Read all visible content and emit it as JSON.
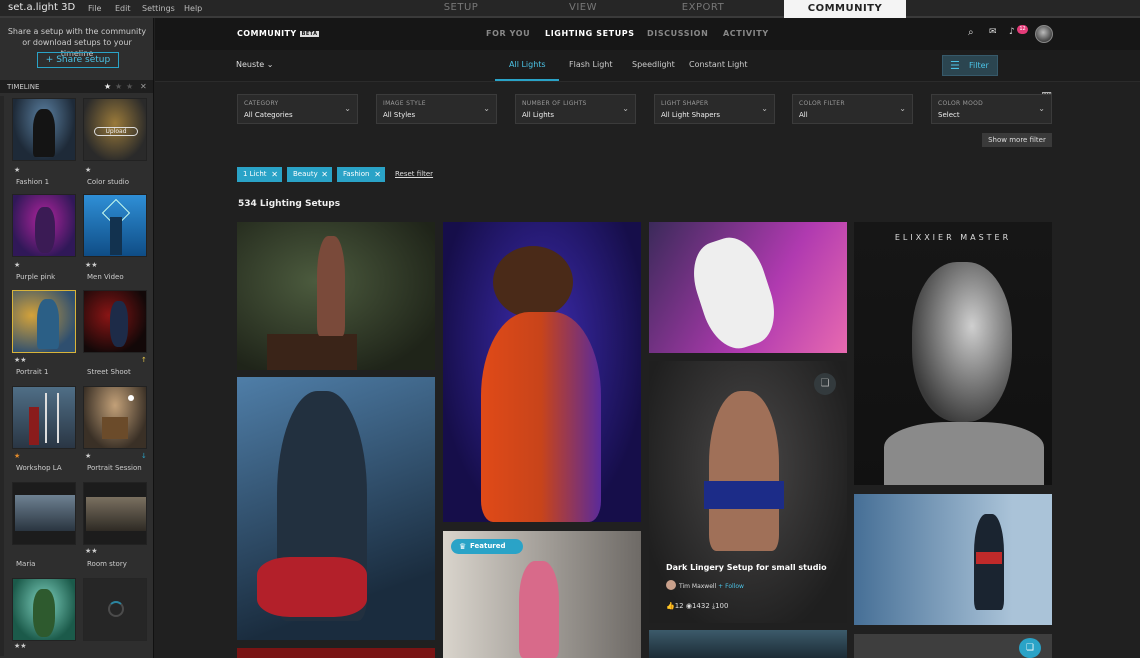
{
  "menubar": {
    "app_title": "set.a.light 3D",
    "menus": [
      "File",
      "Edit",
      "Settings",
      "Help"
    ],
    "modes": [
      "SETUP",
      "VIEW",
      "EXPORT",
      "COMMUNITY"
    ]
  },
  "sidebar": {
    "info": "Share a setup with the community or download setups to your timeline",
    "share_label": "+ Share setup",
    "timeline_label": "TIMELINE",
    "upload_label": "Upload",
    "items": [
      {
        "label": "Fashion 1",
        "stars": "★"
      },
      {
        "label": "Color studio",
        "stars": "★"
      },
      {
        "label": "Purple pink",
        "stars": "★"
      },
      {
        "label": "Men Video",
        "stars": "★★"
      },
      {
        "label": "Portrait 1",
        "stars": "★★"
      },
      {
        "label": "Street Shoot",
        "stars": ""
      },
      {
        "label": "Workshop LA",
        "stars": "★"
      },
      {
        "label": "Portrait Session",
        "stars": "★"
      },
      {
        "label": "Maria",
        "stars": ""
      },
      {
        "label": "Room story",
        "stars": "★★"
      },
      {
        "label": "",
        "stars": "★★"
      },
      {
        "label": "",
        "stars": ""
      }
    ]
  },
  "header": {
    "logo": "COMMUNITY",
    "beta": "BETA",
    "nav": [
      "FOR YOU",
      "LIGHTING SETUPS",
      "DISCUSSION",
      "ACTIVITY"
    ],
    "notifications": "12"
  },
  "subnav": {
    "sort": "Neuste",
    "tabs": [
      "All Lights",
      "Flash Light",
      "Speedlight",
      "Constant Light"
    ],
    "filter_label": "Filter"
  },
  "filters": [
    {
      "label": "CATEGORY",
      "value": "All Categories"
    },
    {
      "label": "IMAGE STYLE",
      "value": "All Styles"
    },
    {
      "label": "NUMBER OF LIGHTS",
      "value": "All Lights"
    },
    {
      "label": "LIGHT SHAPER",
      "value": "All Light Shapers"
    },
    {
      "label": "COLOR FILTER",
      "value": "All"
    },
    {
      "label": "COLOR MOOD",
      "value": "Select"
    }
  ],
  "more_filter": "Show more filter",
  "chips": [
    "1 Licht",
    "Beauty",
    "Fashion"
  ],
  "reset_filter": "Reset filter",
  "results_count": "534 Lighting Setups",
  "cards": {
    "featured": "Featured",
    "overlay": {
      "title": "Dark Lingery Setup for small studio",
      "author": "Tim Maxwell",
      "follow": "+ Follow",
      "stats": "12 ◉1432 ⤓100"
    },
    "elixxier": "ELIXXIER MASTER"
  },
  "colors": {
    "accent": "#2aa3c7",
    "selected_thumb": "#d8b43a",
    "badge": "#e33b78"
  }
}
